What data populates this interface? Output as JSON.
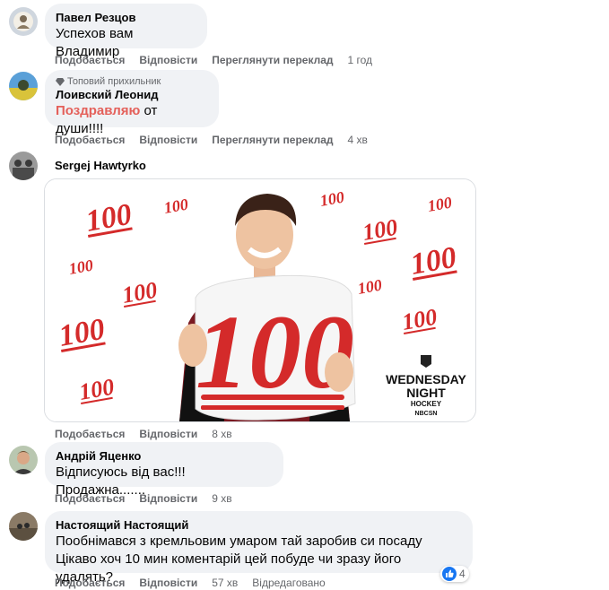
{
  "colors": {
    "bubble": "#f0f2f5",
    "meta": "#65676b",
    "accent": "#e4605a",
    "like": "#1877f2"
  },
  "comments": [
    {
      "author": "Павел Резцов",
      "text": "Успехов вам Владимир",
      "actions": [
        "Подобається",
        "Відповісти",
        "Переглянути переклад"
      ],
      "time": "1 год"
    },
    {
      "badge": "Топовий прихильник",
      "badge_icon": "diamond-icon",
      "author": "Лоивский Леонид",
      "text_highlight": "Поздравляю",
      "text_rest": " от души!!!!",
      "actions": [
        "Подобається",
        "Відповісти",
        "Переглянути переклад"
      ],
      "time": "4 хв"
    },
    {
      "author": "Sergej Hawtyrko",
      "media": {
        "big": "100",
        "sticker": "100",
        "logo_line1": "WEDNESDAY",
        "logo_line2": "NIGHT",
        "logo_line3": "HOCKEY",
        "logo_line4": "NBCSN"
      },
      "actions": [
        "Подобається",
        "Відповісти"
      ],
      "time": "8 хв"
    },
    {
      "author": "Андрій Яценко",
      "text": "Відписуюсь від вас!!! Продажна.......",
      "actions": [
        "Подобається",
        "Відповісти"
      ],
      "time": "9 хв"
    },
    {
      "author": "Настоящий Настоящий",
      "text_line1": "Пообнімався з кремльовим умаром тай заробив си посаду",
      "text_line2": "Цікаво хоч 10 мин коментарій цей побуде чи зразу його удалять?",
      "actions": [
        "Подобається",
        "Відповісти"
      ],
      "time": "57 хв",
      "edited": "Відредаговано",
      "reactions": {
        "icon": "like-icon",
        "count": "4"
      }
    }
  ]
}
